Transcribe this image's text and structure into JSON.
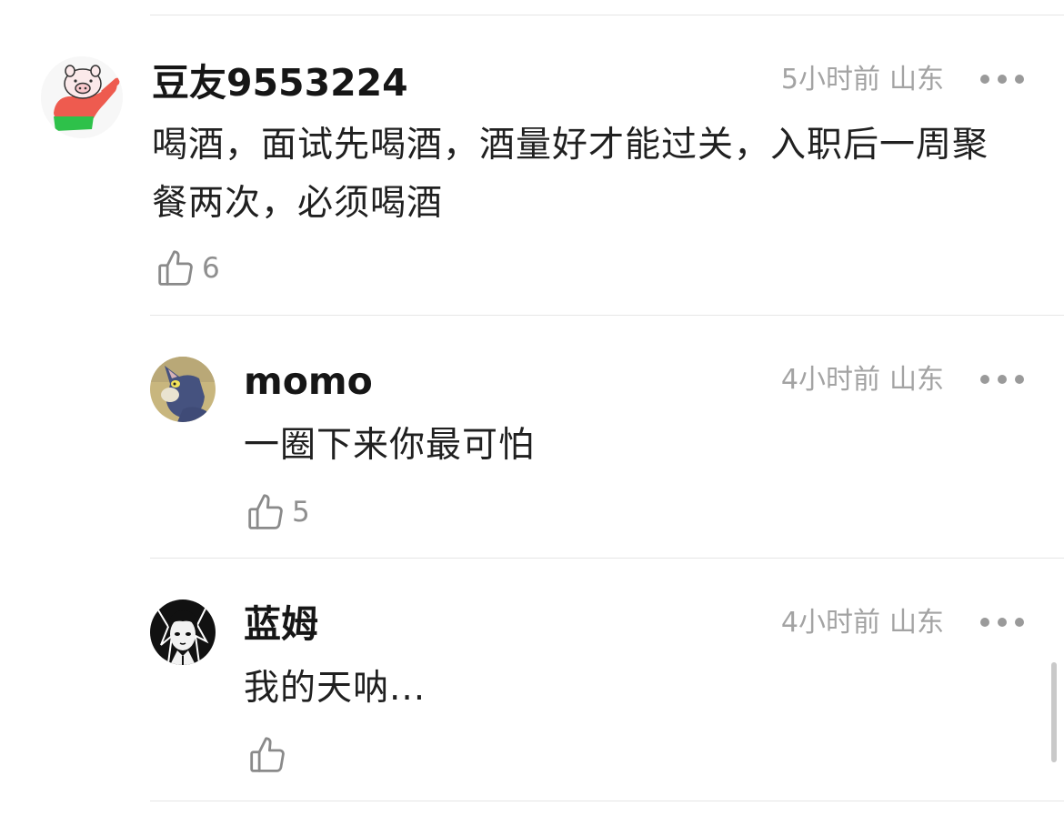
{
  "comments": [
    {
      "username": "豆友9553224",
      "time": "5小时前",
      "location": "山东",
      "content": "喝酒，面试先喝酒，酒量好才能过关，入职后一周聚餐两次，必须喝酒",
      "likes": "6",
      "avatar": "pig-cartoon-avatar"
    },
    {
      "username": "momo",
      "time": "4小时前",
      "location": "山东",
      "content": "一圈下来你最可怕",
      "likes": "5",
      "avatar": "tom-cat-avatar"
    },
    {
      "username": "蓝姆",
      "time": "4小时前",
      "location": "山东",
      "content": "我的天呐...",
      "likes": "",
      "avatar": "manga-portrait-avatar"
    }
  ],
  "icons": {
    "like": "thumbs-up-icon",
    "more": "more-dots-icon"
  },
  "colors": {
    "meta_text": "#a3a3a3",
    "divider": "#e6e6e6"
  }
}
